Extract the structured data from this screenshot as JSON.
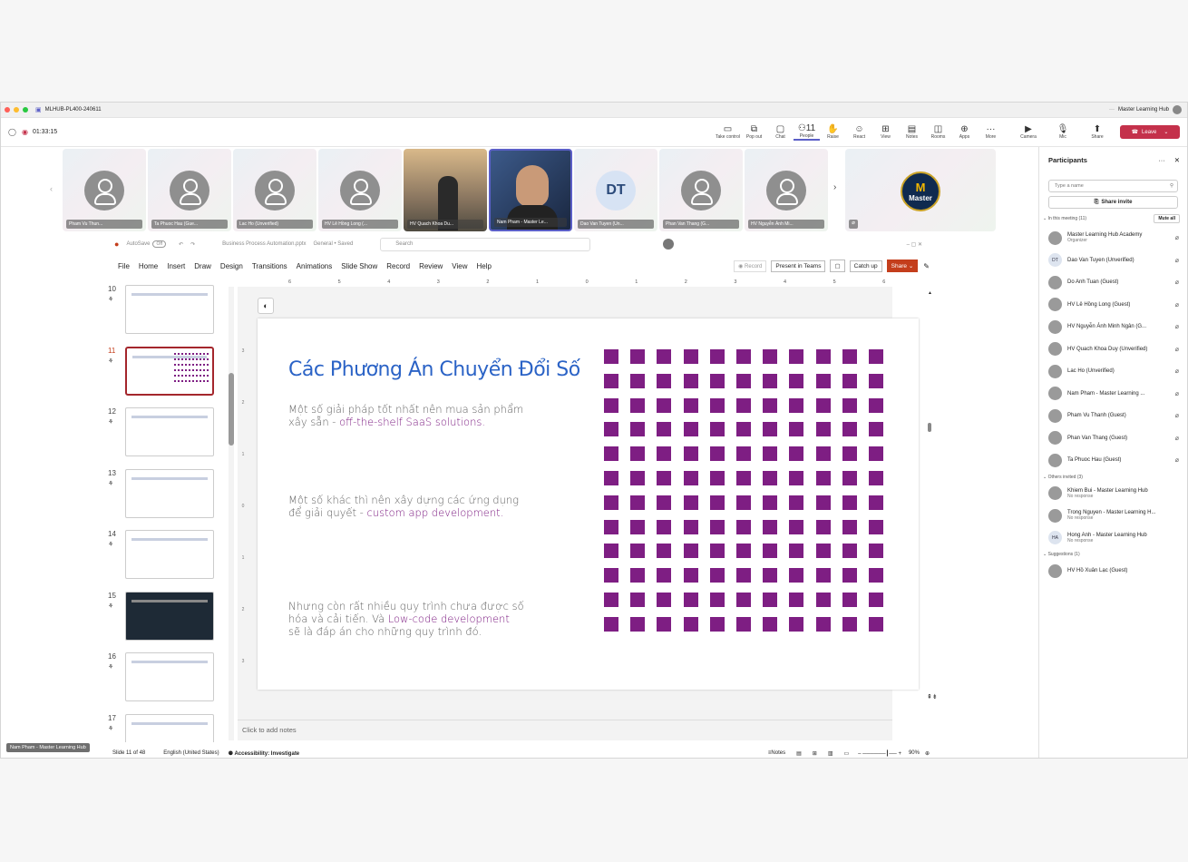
{
  "window": {
    "title": "MLHUB-PL400-240611",
    "account": "Master Learning Hub",
    "timer": "01:33:15"
  },
  "toolbar": [
    {
      "icon": "take-control-icon",
      "label": "Take control",
      "g": "▭"
    },
    {
      "icon": "pop-out-icon",
      "label": "Pop out",
      "g": "⧉"
    },
    {
      "icon": "chat-icon",
      "label": "Chat",
      "g": "▢"
    },
    {
      "icon": "people-icon",
      "label": "People",
      "g": "⚇",
      "badge": "11"
    },
    {
      "icon": "raise-hand-icon",
      "label": "Raise",
      "g": "✋"
    },
    {
      "icon": "react-icon",
      "label": "React",
      "g": "☺"
    },
    {
      "icon": "view-icon",
      "label": "View",
      "g": "⊞"
    },
    {
      "icon": "notes-icon",
      "label": "Notes",
      "g": "▤"
    },
    {
      "icon": "rooms-icon",
      "label": "Rooms",
      "g": "◫"
    },
    {
      "icon": "apps-icon",
      "label": "Apps",
      "g": "⊕"
    },
    {
      "icon": "more-icon",
      "label": "More",
      "g": "···"
    }
  ],
  "devices": [
    {
      "icon": "camera-off-icon",
      "label": "Camera",
      "g": "▶"
    },
    {
      "icon": "mic-off-icon",
      "label": "Mic",
      "g": "🎙"
    },
    {
      "icon": "share-icon",
      "label": "Share",
      "g": "⬆"
    }
  ],
  "leave_label": "Leave",
  "tiles": [
    "Pham Vu Thun...",
    "Ta Phuoc Hau (Gue...",
    "Lac Ho (Unverified)",
    "HV Lê Hồng Long (...",
    "HV Quach Khoa Du...",
    "Nam Pham - Master Le...",
    "Dao Van Tuyen (Un...",
    "Phan Van Thang (G...",
    "HV Nguyễn Ánh Mi..."
  ],
  "dt_initials": "DT",
  "master_logo": "Master",
  "presenter_label": "Nam Pham - Master Learning Hub",
  "participants": {
    "title": "Participants",
    "search_placeholder": "Type a name",
    "share_invite": "Share invite",
    "in_meeting": "In this meeting (11)",
    "mute_all": "Mute all",
    "people": [
      {
        "name": "Master Learning Hub Academy",
        "sub": "Organizer"
      },
      {
        "name": "Dao Van Tuyen (Unverified)",
        "init": "DT"
      },
      {
        "name": "Do Anh Tuan (Guest)"
      },
      {
        "name": "HV Lê Hồng Long (Guest)"
      },
      {
        "name": "HV Nguyễn Ánh Minh Ngân (G..."
      },
      {
        "name": "HV Quach Khoa Duy (Unverified)"
      },
      {
        "name": "Lac Ho (Unverified)"
      },
      {
        "name": "Nam Pham - Master Learning ..."
      },
      {
        "name": "Pham Vu Thanh (Guest)"
      },
      {
        "name": "Phan Van Thang (Guest)"
      },
      {
        "name": "Ta Phuoc Hau (Guest)"
      }
    ],
    "others": "Others invited (3)",
    "invited": [
      {
        "name": "Khiem Bui - Master Learning Hub",
        "sub": "No response"
      },
      {
        "name": "Trong Nguyen - Master Learning H...",
        "sub": "No response"
      },
      {
        "name": "Hong Anh - Master Learning Hub",
        "sub": "No response",
        "init": "HA"
      }
    ],
    "sugg": "Suggestions (1)",
    "suggestions": [
      {
        "name": "HV Hồ Xuân Lạc (Guest)"
      }
    ]
  },
  "ppt": {
    "autosave": "AutoSave",
    "autosave_state": "Off",
    "file": "Business Process Automation.pptx",
    "label": "General • Saved",
    "search": "Search",
    "tabs": [
      "File",
      "Home",
      "Insert",
      "Draw",
      "Design",
      "Transitions",
      "Animations",
      "Slide Show",
      "Record",
      "Review",
      "View",
      "Help"
    ],
    "record": "Record",
    "present": "Present in Teams",
    "catchup": "Catch up",
    "share": "Share",
    "ruler": [
      "6",
      "5",
      "4",
      "3",
      "2",
      "1",
      "0",
      "1",
      "2",
      "3",
      "4",
      "5",
      "6"
    ],
    "slide_nums": [
      "10",
      "11",
      "12",
      "13",
      "14",
      "15",
      "16",
      "17"
    ],
    "notes_placeholder": "Click to add notes",
    "status_slide": "Slide 11 of 48",
    "status_lang": "English (United States)",
    "status_access": "Accessibility: Investigate",
    "status_notes": "Notes",
    "zoom": "90%"
  },
  "slide": {
    "title": "Các Phương Án Chuyển Đổi Số",
    "p1a": "Một số giải pháp tốt nhất nên mua sản phẩm xây sẵn - ",
    "p1b": "off-the-shelf SaaS solutions.",
    "p2a": "Một số khác thì nên xây dựng các ứng dụng để giải quyết - ",
    "p2b": "custom app development.",
    "p3a": "Nhưng còn rất nhiều quy trình chưa được số hóa và cải tiến. Và ",
    "p3b": "Low-code development",
    "p3c": " sẽ là đáp án cho những quy trình đó.",
    "accent": "#7e1e83",
    "title_color": "#2b63c6"
  }
}
